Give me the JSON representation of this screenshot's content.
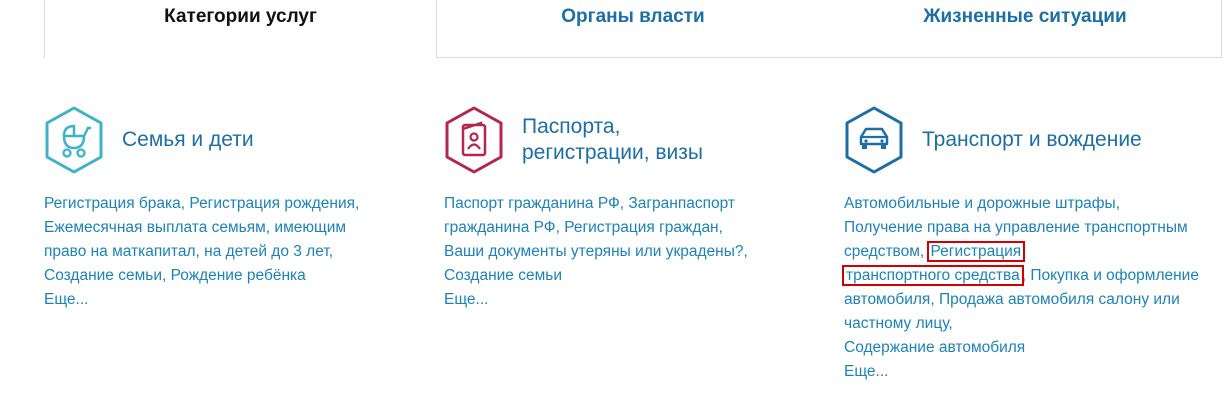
{
  "tabs": [
    {
      "label": "Категории услуг",
      "active": true
    },
    {
      "label": "Органы власти",
      "active": false
    },
    {
      "label": "Жизненные ситуации",
      "active": false
    }
  ],
  "colors": {
    "link": "#1c82b8",
    "title": "#1c6ea4",
    "family_icon": "#3fb3c6",
    "passport_icon": "#b4274a",
    "transport_icon": "#1c6ea4",
    "highlight": "#d20000"
  },
  "cards": [
    {
      "icon": "baby-stroller-icon",
      "title": "Семья и дети",
      "links": [
        "Регистрация брака",
        "Регистрация рождения",
        "Ежемесячная выплата семьям, имеющим право на маткапитал, на детей до 3 лет",
        "Создание семьи",
        "Рождение ребёнка"
      ],
      "more": "Еще..."
    },
    {
      "icon": "passport-icon",
      "title_line1": "Паспорта,",
      "title_line2": "регистрации, визы",
      "links": [
        "Паспорт гражданина РФ",
        "Загранпаспорт гражданина РФ",
        "Регистрация граждан",
        "Ваши документы утеряны или украдены?",
        "Создание семьи"
      ],
      "more": "Еще..."
    },
    {
      "icon": "car-icon",
      "title": "Транспорт и вождение",
      "links": [
        "Автомобильные и дорожные штрафы",
        "Получение права на управление транспортным средством",
        "Регистрация",
        "транспортного средства",
        "Покупка и оформление автомобиля",
        "Продажа автомобиля салону или частному лицу",
        "Содержание автомобиля"
      ],
      "more": "Еще..."
    }
  ]
}
